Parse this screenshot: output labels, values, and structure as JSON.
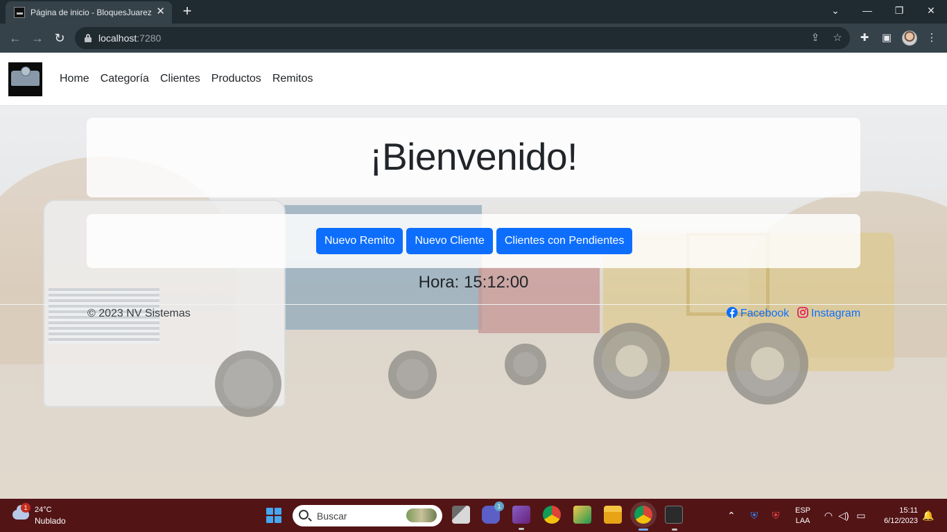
{
  "browser": {
    "tab_title": "Página de inicio - BloquesJuarez",
    "tab_close": "✕",
    "new_tab": "+",
    "url_host": "localhost",
    "url_port": ":7280"
  },
  "navbar": {
    "links": [
      "Home",
      "Categoría",
      "Clientes",
      "Productos",
      "Remitos"
    ]
  },
  "welcome": {
    "title": "¡Bienvenido!"
  },
  "actions": {
    "buttons": [
      "Nuevo Remito",
      "Nuevo Cliente",
      "Clientes con Pendientes"
    ]
  },
  "clock": {
    "text": "Hora: 15:12:00"
  },
  "footer": {
    "copyright": "© 2023 NV Sistemas",
    "facebook": "Facebook",
    "instagram": "Instagram"
  },
  "colors": {
    "primary_button": "#0d6efd",
    "link": "#0d6efd",
    "taskbar": "#531416",
    "browser_frame": "#202b31"
  },
  "taskbar": {
    "weather_badge": "1",
    "weather_temp": "24°C",
    "weather_condition": "Nublado",
    "search_placeholder": "Buscar",
    "teams_badge": "1",
    "lang_top": "ESP",
    "lang_bottom": "LAA",
    "time": "15:11",
    "date": "6/12/2023"
  }
}
